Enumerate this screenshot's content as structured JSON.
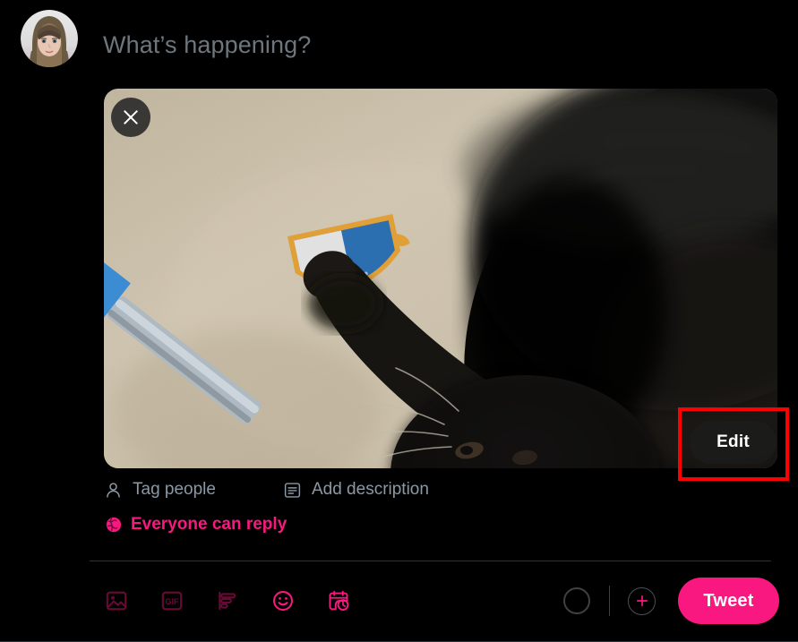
{
  "composer": {
    "placeholder": "What’s happening?",
    "avatar_alt": "user-avatar"
  },
  "media": {
    "close_label": "×",
    "edit_label": "Edit",
    "image_description": "Black cat lying on beige carpet beside a blue and white toy sword and shield",
    "actions": [
      {
        "icon": "person-icon",
        "label": "Tag people"
      },
      {
        "icon": "description-icon",
        "label": "Add description"
      }
    ]
  },
  "reply_scope": {
    "icon": "globe-icon",
    "label": "Everyone can reply"
  },
  "toolbar": {
    "tools": [
      {
        "name": "media-icon",
        "label": "Media",
        "enabled": false
      },
      {
        "name": "gif-icon",
        "label": "GIF",
        "enabled": false
      },
      {
        "name": "poll-icon",
        "label": "Poll",
        "enabled": false
      },
      {
        "name": "emoji-icon",
        "label": "Emoji",
        "enabled": true
      },
      {
        "name": "schedule-icon",
        "label": "Schedule",
        "enabled": true
      }
    ],
    "gif_text": "GIF",
    "char_counter_label": "character-count",
    "add_label": "+",
    "tweet_label": "Tweet"
  },
  "colors": {
    "accent": "#F91880",
    "background": "#000000",
    "muted_text": "#8B98A5",
    "placeholder_text": "#6E767D",
    "divider": "#2F3336",
    "annotation": "#FF0000"
  },
  "annotation": {
    "target": "edit-button",
    "color": "#FF0000"
  }
}
